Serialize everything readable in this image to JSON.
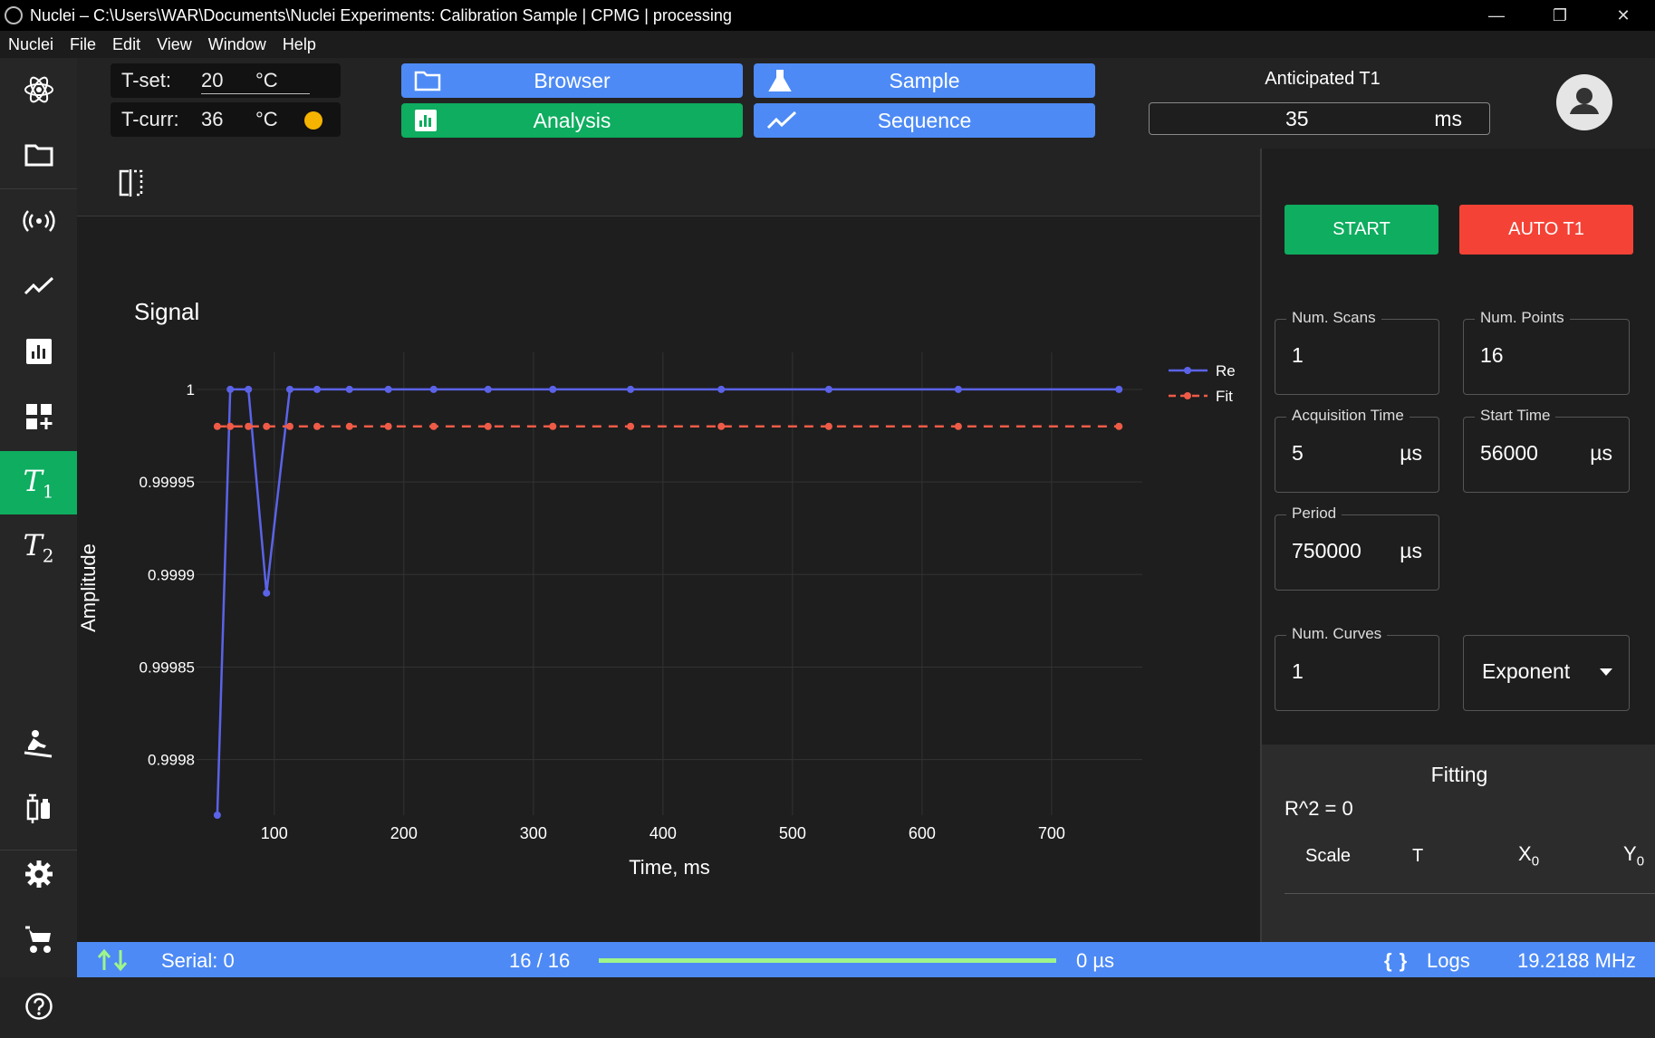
{
  "window": {
    "title": "Nuclei – C:\\Users\\WAR\\Documents\\Nuclei Experiments: Calibration Sample | CPMG | processing",
    "minimize": "—",
    "maximize": "❐",
    "close": "✕"
  },
  "menu": [
    "Nuclei",
    "File",
    "Edit",
    "View",
    "Window",
    "Help"
  ],
  "sidebar": {
    "items": [
      {
        "icon": "atom-icon"
      },
      {
        "icon": "folder-icon"
      },
      {
        "icon": "broadcast-icon"
      },
      {
        "icon": "trend-icon"
      },
      {
        "icon": "analytics-icon"
      },
      {
        "icon": "dashboard-add-icon"
      },
      {
        "icon": "t1-icon",
        "label": "T",
        "sub": "1",
        "active": true
      },
      {
        "icon": "t2-icon",
        "label": "T",
        "sub": "2"
      },
      {
        "icon": "sledding-icon"
      },
      {
        "icon": "vaccine-icon"
      },
      {
        "icon": "gear-icon"
      },
      {
        "icon": "stroller-icon"
      },
      {
        "icon": "help-icon"
      }
    ]
  },
  "temps": {
    "tset_label": "T-set:",
    "tset_value": "20",
    "tset_unit": "°C",
    "tcurr_label": "T-curr:",
    "tcurr_value": "36",
    "tcurr_unit": "°C",
    "status_color": "#f5b400"
  },
  "nav": {
    "browser": "Browser",
    "sample": "Sample",
    "analysis": "Analysis",
    "sequence": "Sequence"
  },
  "anticipated": {
    "label": "Anticipated T1",
    "value": "35",
    "unit": "ms"
  },
  "controls": {
    "start": "START",
    "auto_t1": "AUTO T1",
    "start_color": "#0ead5f",
    "auto_color": "#f44336",
    "num_scans_label": "Num. Scans",
    "num_scans": "1",
    "num_points_label": "Num. Points",
    "num_points": "16",
    "acq_time_label": "Acquisition Time",
    "acq_time": "5",
    "acq_unit": "µs",
    "start_time_label": "Start Time",
    "start_time": "56000",
    "start_unit": "µs",
    "period_label": "Period",
    "period": "750000",
    "period_unit": "µs",
    "num_curves_label": "Num. Curves",
    "num_curves": "1",
    "curve_type": "Exponent"
  },
  "fitting": {
    "title": "Fitting",
    "r2": "R^2 = 0",
    "col_scale": "Scale",
    "col_t": "T",
    "col_x0": "X",
    "col_x0_sub": "0",
    "col_y0": "Y",
    "col_y0_sub": "0"
  },
  "status": {
    "serial": "Serial: 0",
    "progress_text": "16 / 16",
    "progress": 1.0,
    "progress_color": "#9ef58a",
    "time": "0 µs",
    "logs": "Logs",
    "freq": "19.2188 MHz"
  },
  "chart_data": {
    "type": "line",
    "title": "Signal",
    "xlabel": "Time, ms",
    "ylabel": "Amplitude",
    "xlim": [
      40,
      770
    ],
    "ylim": [
      0.99977,
      1.00002
    ],
    "xticks": [
      100,
      200,
      300,
      400,
      500,
      600,
      700
    ],
    "yticks": [
      {
        "v": 1.0,
        "label": "1"
      },
      {
        "v": 0.99995,
        "label": "0.99995"
      },
      {
        "v": 0.9999,
        "label": "0.9999"
      },
      {
        "v": 0.99985,
        "label": "0.99985"
      },
      {
        "v": 0.9998,
        "label": "0.9998"
      }
    ],
    "grid": true,
    "legend": "top-right",
    "series": [
      {
        "name": "Re",
        "color": "#5b63e8",
        "dashed": false,
        "x": [
          56,
          66,
          80,
          94,
          112,
          133,
          158,
          188,
          223,
          265,
          315,
          375,
          445,
          528,
          628,
          752
        ],
        "y": [
          0.99977,
          1.0,
          1.0,
          0.99989,
          1.0,
          1.0,
          1.0,
          1.0,
          1.0,
          1.0,
          1.0,
          1.0,
          1.0,
          1.0,
          1.0,
          1.0
        ]
      },
      {
        "name": "Fit",
        "color": "#ef5b47",
        "dashed": true,
        "x": [
          56,
          66,
          80,
          94,
          112,
          133,
          158,
          188,
          223,
          265,
          315,
          375,
          445,
          528,
          628,
          752
        ],
        "y": [
          0.99998,
          0.99998,
          0.99998,
          0.99998,
          0.99998,
          0.99998,
          0.99998,
          0.99998,
          0.99998,
          0.99998,
          0.99998,
          0.99998,
          0.99998,
          0.99998,
          0.99998,
          0.99998
        ]
      }
    ]
  }
}
